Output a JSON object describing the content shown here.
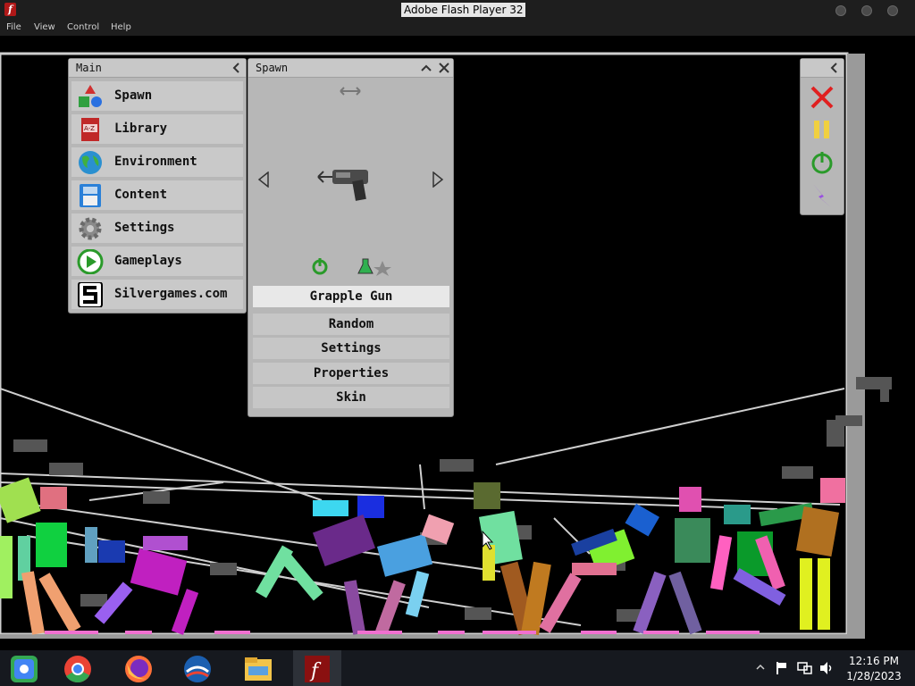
{
  "window": {
    "title": "Adobe Flash Player 32"
  },
  "menubar": {
    "items": [
      "File",
      "View",
      "Control",
      "Help"
    ]
  },
  "main_panel": {
    "title": "Main",
    "items": [
      {
        "label": "Spawn",
        "icon": "shapes-icon"
      },
      {
        "label": "Library",
        "icon": "book-icon"
      },
      {
        "label": "Environment",
        "icon": "globe-icon"
      },
      {
        "label": "Content",
        "icon": "floppy-icon"
      },
      {
        "label": "Settings",
        "icon": "gear-icon"
      },
      {
        "label": "Gameplays",
        "icon": "play-icon"
      },
      {
        "label": "Silvergames.com",
        "icon": "silvergames-logo-icon"
      }
    ]
  },
  "spawn_panel": {
    "title": "Spawn",
    "selected": "Grapple Gun",
    "buttons": [
      "Random",
      "Settings",
      "Properties",
      "Skin"
    ]
  },
  "controls": {
    "items": [
      "close-icon",
      "pause-icon",
      "power-icon",
      "lightning-icon"
    ]
  },
  "taskbar": {
    "apps": [
      "chrome-remote-icon",
      "chrome-icon",
      "firefox-icon",
      "obama-icon",
      "file-explorer-icon",
      "flash-player-icon"
    ],
    "time": "12:16 PM",
    "date": "1/28/2023"
  },
  "colors": {
    "panel": "#b7b7b7",
    "item": "#c9c9c9",
    "titlebar": "#1e1e1e",
    "taskbar": "#16191f"
  }
}
